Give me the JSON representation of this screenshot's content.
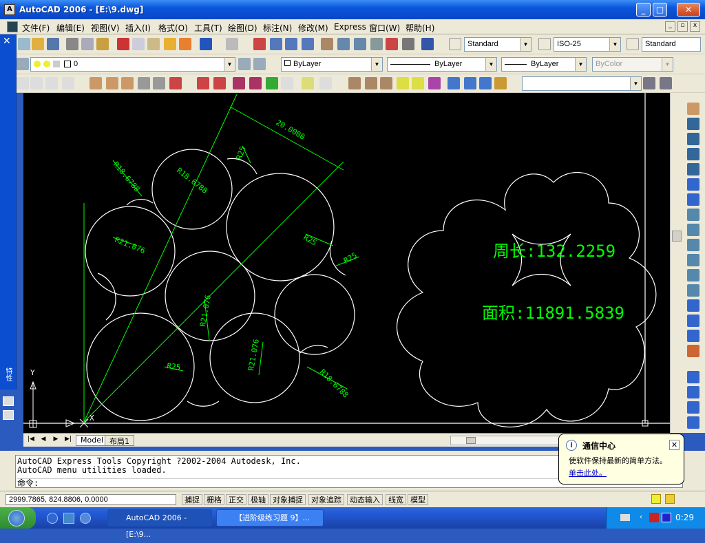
{
  "window": {
    "title": "AutoCAD 2006 - [E:\\9.dwg]",
    "min_label": "_",
    "max_label": "□",
    "close_label": "✕"
  },
  "menu": {
    "items": [
      "文件(F)",
      "编辑(E)",
      "视图(V)",
      "插入(I)",
      "格式(O)",
      "工具(T)",
      "绘图(D)",
      "标注(N)",
      "修改(M)",
      "Express",
      "窗口(W)",
      "帮助(H)"
    ]
  },
  "toolbar1": {
    "text_style": "Standard",
    "dim_style": "ISO-25",
    "table_style": "Standard"
  },
  "toolbar2": {
    "layer": "0",
    "color": "ByLayer",
    "linetype": "ByLayer",
    "lineweight": "ByLayer",
    "plotstyle": "ByColor"
  },
  "drawing": {
    "dims": {
      "d20": "20.0000",
      "r25a": "R25",
      "r18a": "R18.6788",
      "r18b": "R18.6788",
      "r21a": "R21.076",
      "r25b": "R25",
      "r25c": "R25",
      "r21b": "R21.076",
      "r25d": "R25",
      "r21c": "R21.076",
      "r18c": "R18.6788"
    },
    "perimeter": "周长:132.2259",
    "area": "面积:11891.5839",
    "ucs_y": "Y",
    "ucs_x": "X"
  },
  "layout_tabs": [
    "Model",
    "布局1"
  ],
  "command": {
    "line1": "AutoCAD Express Tools Copyright ?2002-2004 Autodesk, Inc.",
    "line2": "AutoCAD menu utilities loaded.",
    "prompt": "命令:"
  },
  "status": {
    "coords": "2999.7865, 824.8806, 0.0000",
    "buttons": [
      "捕捉",
      "栅格",
      "正交",
      "极轴",
      "对象捕捉",
      "对象追踪",
      "动态输入",
      "线宽",
      "模型"
    ]
  },
  "balloon": {
    "title": "通信中心",
    "line1": "使软件保持最新的简单方法。",
    "link": "单击此处。"
  },
  "taskbar": {
    "task1": "AutoCAD 2006 - [E:\\9...",
    "task2": "【进阶级练习题 9】...",
    "time": "0:29"
  },
  "palette": {
    "label": "特性"
  }
}
